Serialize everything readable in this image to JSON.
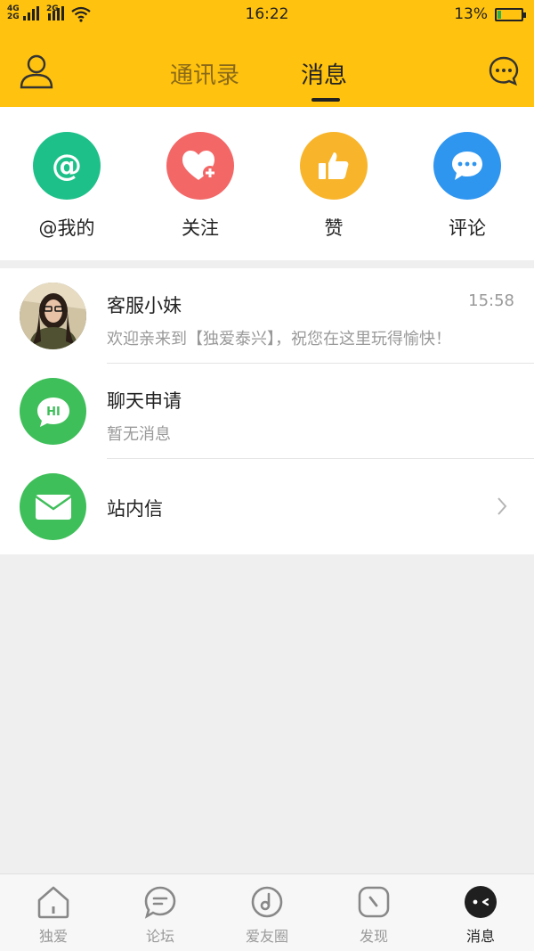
{
  "status_bar": {
    "network_left": "4G",
    "network_left_2": "2G",
    "network_mid": "2G",
    "time": "16:22",
    "battery": "13%",
    "battery_level": 0.13
  },
  "header": {
    "tabs": [
      {
        "label": "通讯录",
        "active": false
      },
      {
        "label": "消息",
        "active": true
      }
    ],
    "icons": {
      "left": "user-icon",
      "right": "chat-bubble-icon"
    }
  },
  "quick_actions": [
    {
      "label": "@我的",
      "icon": "at-icon",
      "color": "#1ec08a"
    },
    {
      "label": "关注",
      "icon": "heart-plus-icon",
      "color": "#f36767"
    },
    {
      "label": "赞",
      "icon": "thumbs-up-icon",
      "color": "#f8b52c"
    },
    {
      "label": "评论",
      "icon": "comment-icon",
      "color": "#2f96f0"
    }
  ],
  "messages": [
    {
      "title": "客服小妹",
      "subtitle": "欢迎亲来到【独爱泰兴】，祝您在这里玩得愉快！",
      "time": "15:58"
    },
    {
      "title": "聊天申请",
      "subtitle": "暂无消息",
      "badge_text": "HI"
    },
    {
      "title": "站内信"
    }
  ],
  "bottom_nav": [
    {
      "label": "独爱",
      "icon": "home-icon",
      "active": false
    },
    {
      "label": "论坛",
      "icon": "forum-icon",
      "active": false
    },
    {
      "label": "爱友圈",
      "icon": "music-circle-icon",
      "active": false
    },
    {
      "label": "发现",
      "icon": "compass-icon",
      "active": false
    },
    {
      "label": "消息",
      "icon": "message-face-icon",
      "active": true
    }
  ],
  "colors": {
    "accent": "#ffc20e",
    "green": "#3fbf5a"
  }
}
